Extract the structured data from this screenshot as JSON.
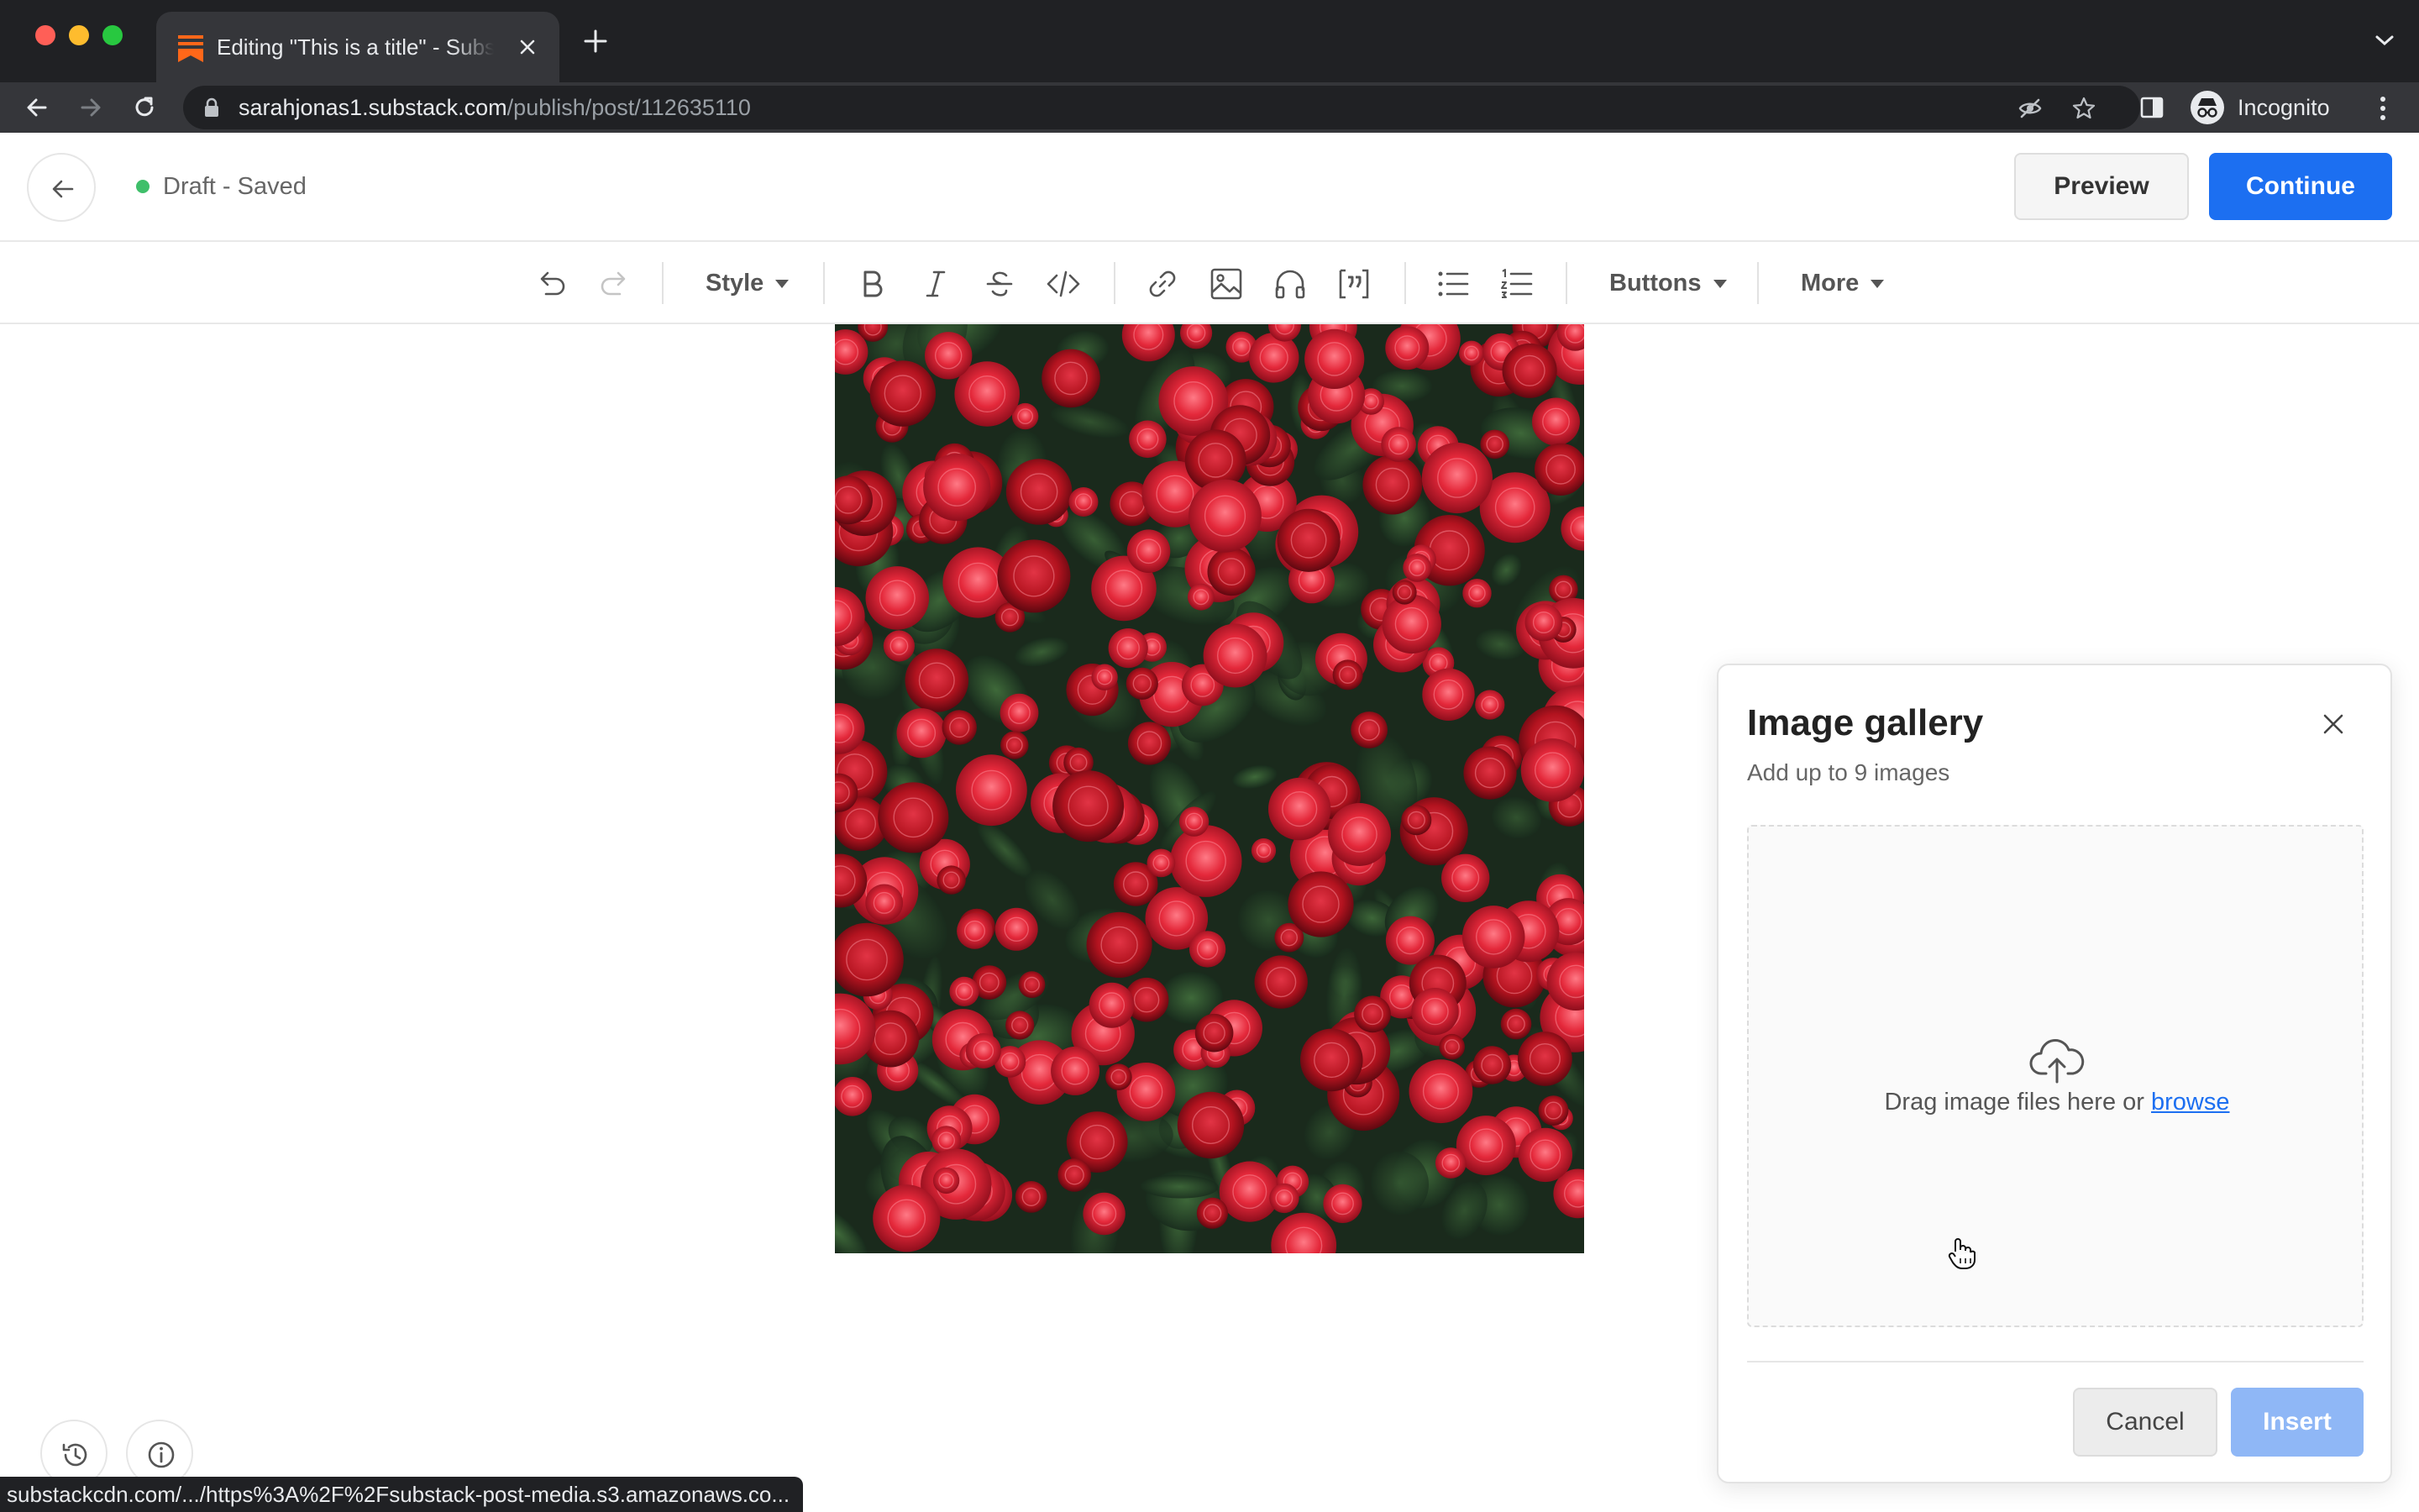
{
  "browser": {
    "tab_title": "Editing \"This is a title\" - Substack",
    "url_host": "sarahjonas1.substack.com",
    "url_path": "/publish/post/112635110",
    "profile_label": "Incognito"
  },
  "header": {
    "status": "Draft - Saved",
    "preview_label": "Preview",
    "continue_label": "Continue"
  },
  "toolbar": {
    "style_label": "Style",
    "buttons_label": "Buttons",
    "more_label": "More",
    "icons": [
      "undo-icon",
      "redo-icon",
      "bold-icon",
      "italic-icon",
      "strikethrough-icon",
      "code-icon",
      "link-icon",
      "image-icon",
      "audio-icon",
      "quote-icon",
      "bullet-list-icon",
      "numbered-list-icon"
    ]
  },
  "modal": {
    "title": "Image gallery",
    "subtitle": "Add up to 9 images",
    "drop_text": "Drag image files here or",
    "browse_label": "browse",
    "cancel_label": "Cancel",
    "insert_label": "Insert"
  },
  "status_bar": {
    "link_preview": "substackcdn.com/.../https%3A%2F%2Fsubstack-post-media.s3.amazonaws.co..."
  },
  "colors": {
    "accent": "#1c6ff1",
    "insert_disabled": "#8fb7f6",
    "saved_dot": "#3fbf6a",
    "substack_orange": "#ff6719"
  }
}
